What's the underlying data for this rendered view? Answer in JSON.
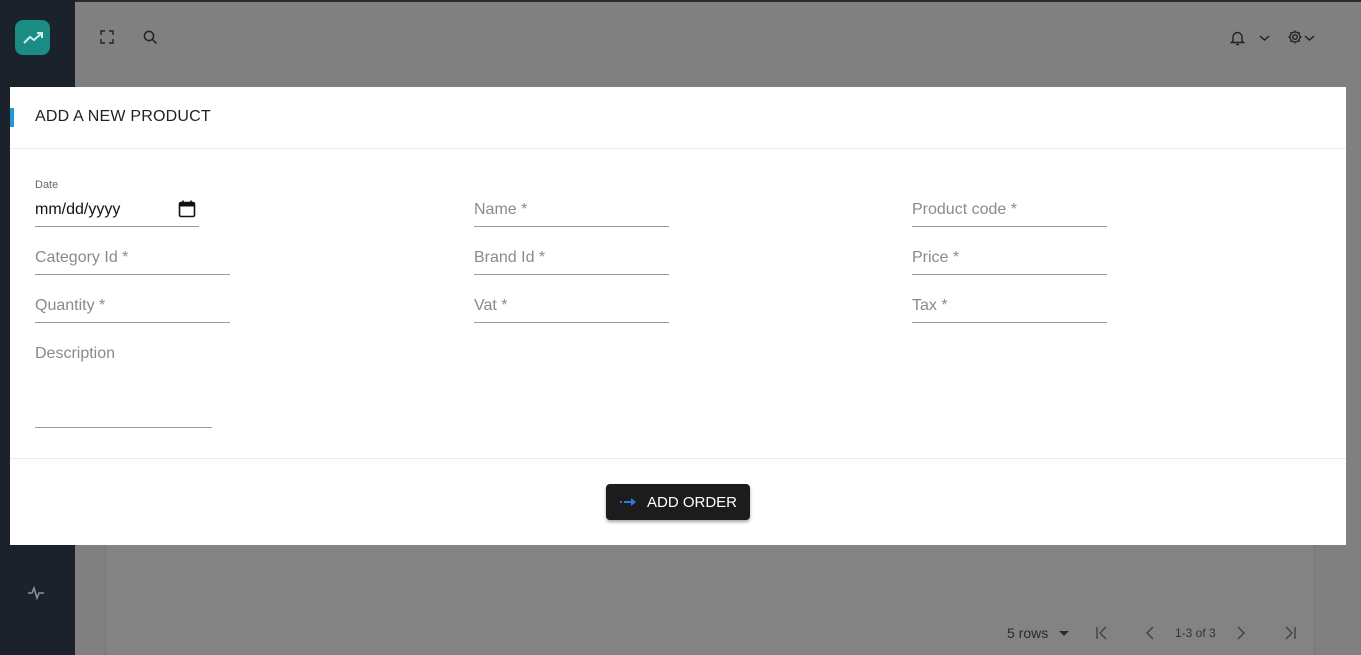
{
  "modal": {
    "title": "ADD A NEW PRODUCT",
    "date": {
      "label": "Date",
      "value": "mm/dd/yyyy"
    },
    "fields": {
      "name": "Name *",
      "product_code": "Product code *",
      "category_id": "Category Id *",
      "brand_id": "Brand Id *",
      "price": "Price *",
      "quantity": "Quantity *",
      "vat": "Vat *",
      "tax": "Tax *",
      "description": "Description"
    },
    "submit_label": "ADD ORDER"
  },
  "pagination": {
    "rows_label": "5 rows",
    "range": "1-3 of 3"
  },
  "colors": {
    "accent": "#1e9bd7",
    "logo": "#1a8c84",
    "sidebar": "#1b222b",
    "button": "#1c1c1c"
  },
  "icons": [
    "trending-up-icon",
    "fullscreen-icon",
    "search-icon",
    "bell-icon",
    "chevron-down-icon",
    "gear-icon",
    "calendar-icon",
    "arrow-right-icon",
    "pulse-icon",
    "first-page-icon",
    "prev-page-icon",
    "next-page-icon",
    "last-page-icon"
  ]
}
